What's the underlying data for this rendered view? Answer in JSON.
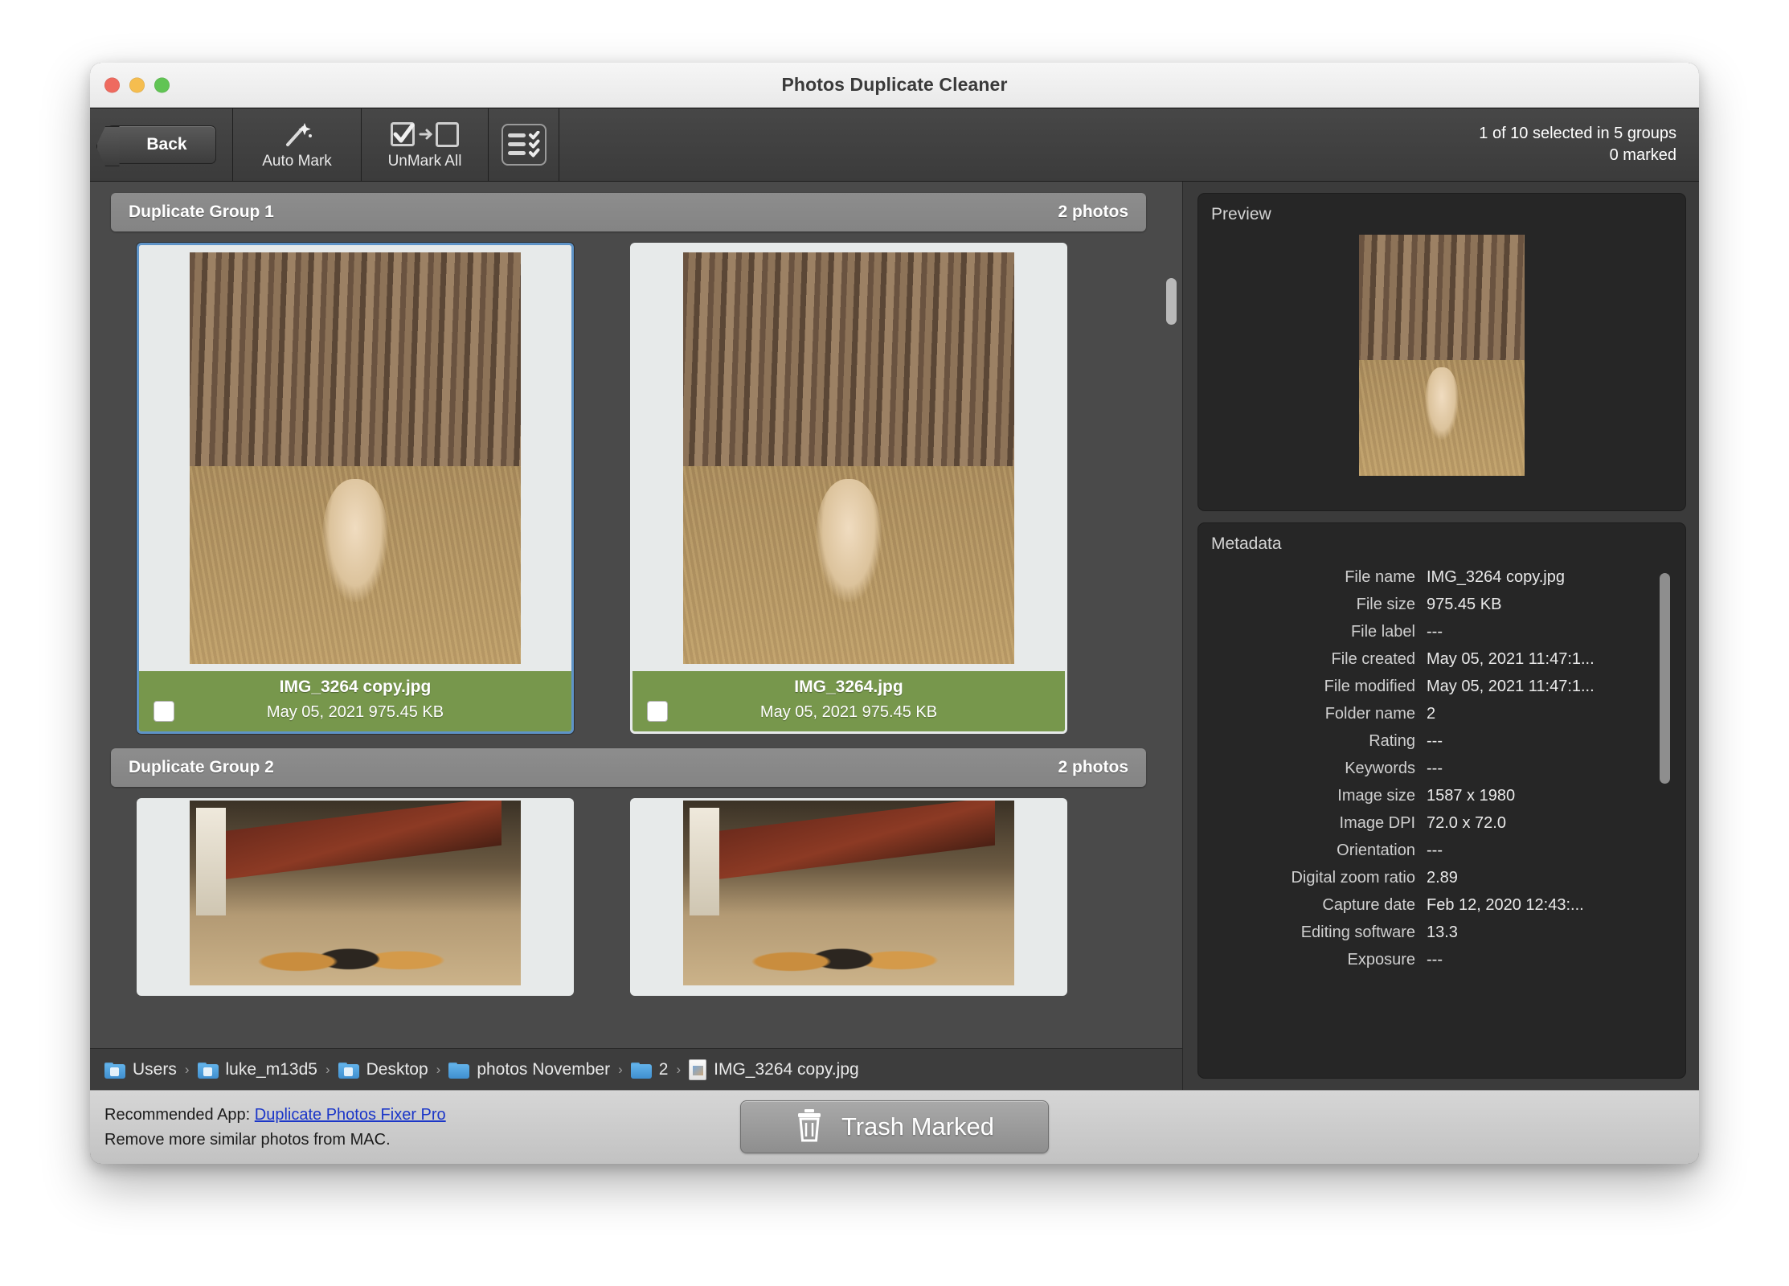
{
  "window": {
    "title": "Photos Duplicate Cleaner",
    "traffic_lights": [
      "close-button",
      "minimize-button",
      "zoom-button"
    ]
  },
  "toolbar": {
    "back_label": "Back",
    "auto_mark_label": "Auto Mark",
    "unmark_all_label": "UnMark All",
    "view_icon_name": "list-view-icon",
    "status_line1": "1 of 10 selected in 5 groups",
    "status_line2": "0 marked"
  },
  "groups": [
    {
      "title": "Duplicate Group 1",
      "count_label": "2 photos",
      "photos": [
        {
          "filename": "IMG_3264 copy.jpg",
          "meta": "May 05, 2021  975.45 KB",
          "selected": true,
          "checked": false,
          "image_kind": "dog-in-woods"
        },
        {
          "filename": "IMG_3264.jpg",
          "meta": "May 05, 2021  975.45 KB",
          "selected": false,
          "checked": false,
          "image_kind": "dog-in-woods"
        }
      ]
    },
    {
      "title": "Duplicate Group 2",
      "count_label": "2 photos",
      "photos": [
        {
          "filename": "",
          "meta": "",
          "selected": false,
          "checked": false,
          "image_kind": "baby-chicks"
        },
        {
          "filename": "",
          "meta": "",
          "selected": false,
          "checked": false,
          "image_kind": "baby-chicks"
        }
      ]
    }
  ],
  "breadcrumb": [
    {
      "label": "Users",
      "icon": "folder-icon"
    },
    {
      "label": "luke_m13d5",
      "icon": "folder-icon"
    },
    {
      "label": "Desktop",
      "icon": "folder-icon"
    },
    {
      "label": "photos November",
      "icon": "folder-icon"
    },
    {
      "label": "2",
      "icon": "folder-icon"
    },
    {
      "label": "IMG_3264 copy.jpg",
      "icon": "file-icon"
    }
  ],
  "preview": {
    "title": "Preview"
  },
  "metadata": {
    "title": "Metadata",
    "rows": [
      {
        "key": "File name",
        "value": "IMG_3264 copy.jpg"
      },
      {
        "key": "File size",
        "value": "975.45 KB"
      },
      {
        "key": "File label",
        "value": "---"
      },
      {
        "key": "File created",
        "value": "May 05, 2021 11:47:1..."
      },
      {
        "key": "File modified",
        "value": "May 05, 2021 11:47:1..."
      },
      {
        "key": "Folder name",
        "value": "2"
      },
      {
        "key": "Rating",
        "value": "---"
      },
      {
        "key": "Keywords",
        "value": "---"
      },
      {
        "key": "Image size",
        "value": "1587 x 1980"
      },
      {
        "key": "Image DPI",
        "value": "72.0 x 72.0"
      },
      {
        "key": "Orientation",
        "value": "---"
      },
      {
        "key": "Digital zoom ratio",
        "value": "2.89"
      },
      {
        "key": "Capture date",
        "value": "Feb 12, 2020 12:43:..."
      },
      {
        "key": "Editing software",
        "value": "13.3"
      },
      {
        "key": "Exposure",
        "value": "---"
      }
    ]
  },
  "footer": {
    "recommended_prefix": "Recommended App: ",
    "recommended_link": "Duplicate Photos Fixer Pro",
    "recommended_sub": "Remove more similar photos from MAC.",
    "trash_label": "Trash Marked",
    "trash_icon": "trash-icon"
  },
  "colors": {
    "caption_green": "#77974c",
    "selection_blue": "#5e93c7",
    "link_blue": "#1b36c8",
    "group_header_gray": "#8d8d8d"
  }
}
